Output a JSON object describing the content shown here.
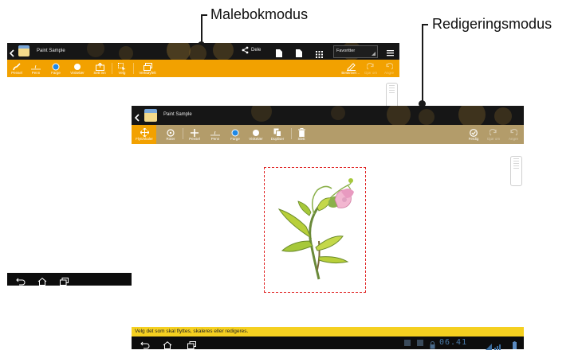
{
  "callouts": {
    "drawing_mode": "Malebokmodus",
    "edit_mode": "Redigeringsmodus"
  },
  "app": {
    "title": "Paint Sample"
  },
  "mode1": {
    "share_label": "Dele",
    "favorites_label": "Favoritter",
    "tools": [
      {
        "label": "Pensel",
        "icon": "brush-icon"
      },
      {
        "label": "Penn",
        "icon": "pen-icon"
      },
      {
        "label": "Farge",
        "icon": "color-icon"
      },
      {
        "label": "Viskelær",
        "icon": "eraser-icon"
      },
      {
        "label": "Sett inn",
        "icon": "insert-icon"
      },
      {
        "label": "Velg",
        "icon": "select-icon"
      },
      {
        "label": "Verktøyfelt",
        "icon": "toolbar-icon"
      }
    ],
    "right_tools": [
      {
        "label": "Beskriver…",
        "icon": "describe-icon"
      },
      {
        "label": "Gjør om",
        "icon": "redo-icon"
      },
      {
        "label": "Angre",
        "icon": "undo-icon"
      }
    ]
  },
  "mode2": {
    "tools": [
      {
        "label": "Flytt/skaler",
        "icon": "move-icon"
      },
      {
        "label": "Roter",
        "icon": "rotate-icon"
      },
      {
        "label": "Pensel",
        "icon": "brush-icon"
      },
      {
        "label": "Penn",
        "icon": "pen-icon"
      },
      {
        "label": "Farge",
        "icon": "color-icon"
      },
      {
        "label": "Viskelær",
        "icon": "eraser-icon"
      },
      {
        "label": "Dupliser",
        "icon": "duplicate-icon"
      },
      {
        "label": "Slett",
        "icon": "delete-icon"
      }
    ],
    "right_tools": [
      {
        "label": "Ferdig",
        "icon": "done-icon"
      },
      {
        "label": "Gjør om",
        "icon": "redo-icon"
      },
      {
        "label": "Angre",
        "icon": "undo-icon"
      }
    ],
    "status_message": "Velg det som skal flyttes, skaleres eller redigeres.",
    "clock": "06.41"
  },
  "colors": {
    "orange_toolbar": "#f2a100",
    "olive_toolbar": "#b39c6a",
    "status_bar": "#f5d020",
    "selection_border": "#e02020"
  }
}
